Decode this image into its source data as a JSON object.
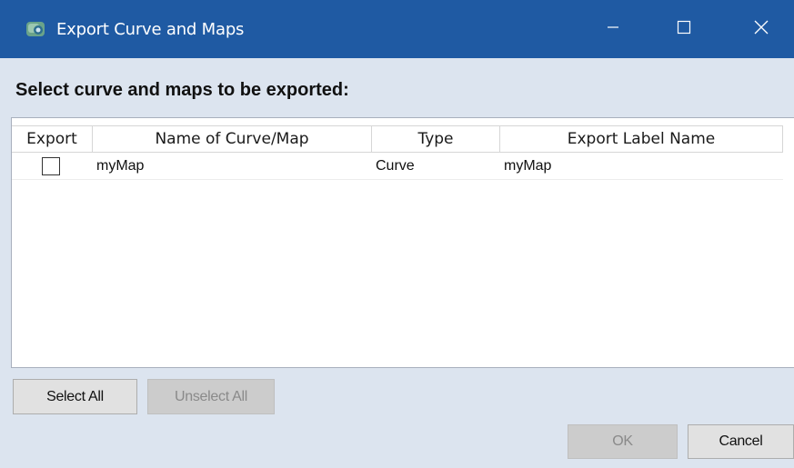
{
  "window": {
    "title": "Export Curve and Maps",
    "icon": "app-cube-icon",
    "controls": [
      "minimize-icon",
      "maximize-icon",
      "close-icon"
    ]
  },
  "heading": "Select curve and maps to be exported:",
  "table": {
    "columns": [
      "Export",
      "Name of Curve/Map",
      "Type",
      "Export Label Name"
    ],
    "rows": [
      {
        "export": false,
        "name": "myMap",
        "type": "Curve",
        "label": "myMap"
      }
    ]
  },
  "buttons": {
    "select_all": "Select All",
    "unselect_all": "Unselect All",
    "ok": "OK",
    "cancel": "Cancel"
  },
  "colors": {
    "titlebar": "#1f5aa3",
    "dialog_background": "#dce4ef"
  }
}
